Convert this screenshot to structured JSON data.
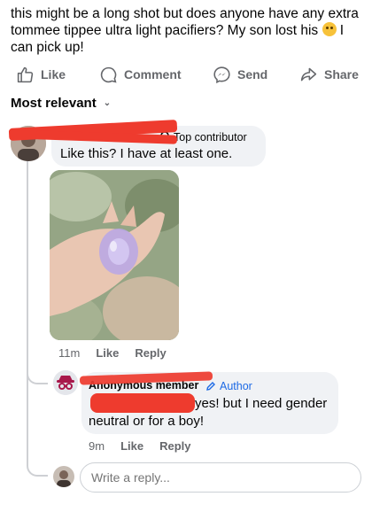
{
  "post": {
    "text_before_emoji": "this might be a long shot but does anyone have any extra tommee tippee ultra light pacifiers? My son lost his ",
    "emoji": "crying-face-emoji",
    "text_after_emoji": " I can pick up!"
  },
  "actions": {
    "like": "Like",
    "comment": "Comment",
    "send": "Send",
    "share": "Share"
  },
  "sort": {
    "label": "Most relevant"
  },
  "comments": [
    {
      "badge": "Top contributor",
      "text": "Like this? I have at least one.",
      "time": "11m",
      "like": "Like",
      "reply": "Reply"
    },
    {
      "author": "Anonymous member",
      "badge": "Author",
      "text_line1": "yes! but I need gender",
      "text_line2": "neutral or for a boy!",
      "time": "9m",
      "like": "Like",
      "reply": "Reply"
    }
  ],
  "reply_input": {
    "placeholder": "Write a reply..."
  },
  "colors": {
    "accent": "#1d6ae5",
    "redaction": "#ee3b2e",
    "bubble": "#f0f2f5",
    "secondary_text": "#65676b"
  }
}
